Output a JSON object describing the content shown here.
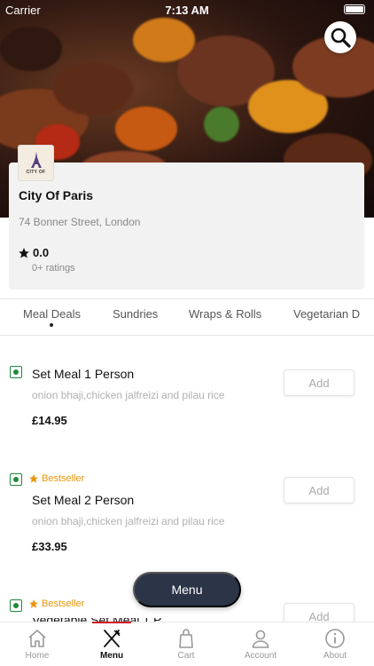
{
  "status_bar": {
    "carrier": "Carrier",
    "time": "7:13 AM"
  },
  "restaurant": {
    "logo_text": "CITY OF",
    "name": "City Of Paris",
    "address": "74 Bonner Street, London",
    "rating": "0.0",
    "rating_count": "0+ ratings"
  },
  "categories": [
    {
      "label": "Meal Deals",
      "active": true
    },
    {
      "label": "Sundries",
      "active": false
    },
    {
      "label": "Wraps & Rolls",
      "active": false
    },
    {
      "label": "Vegetarian D",
      "active": false
    }
  ],
  "items": [
    {
      "title": "Set Meal 1 Person",
      "description": "onion bhaji,chicken jalfreizi and pilau rice",
      "price": "£14.95",
      "badge": "",
      "add_label": "Add"
    },
    {
      "title": "Set Meal 2 Person",
      "description": "onion bhaji,chicken jalfreizi and pilau rice",
      "price": "£33.95",
      "badge": "Bestseller",
      "add_label": "Add"
    },
    {
      "title": "Vegetable Set Meal 1 P",
      "badge": "Bestseller",
      "add_label": "Add"
    }
  ],
  "menu_button": "Menu",
  "bottom_nav": [
    {
      "label": "Home",
      "icon": "home-icon",
      "active": false
    },
    {
      "label": "Menu",
      "icon": "fork-knife-icon",
      "active": true
    },
    {
      "label": "Cart",
      "icon": "bag-icon",
      "active": false
    },
    {
      "label": "Account",
      "icon": "person-icon",
      "active": false
    },
    {
      "label": "About",
      "icon": "info-icon",
      "active": false
    }
  ],
  "colors": {
    "accent": "#d0121b",
    "veg_green": "#1f8a3a",
    "bestseller": "#e8960c",
    "fab": "#2c3547"
  }
}
